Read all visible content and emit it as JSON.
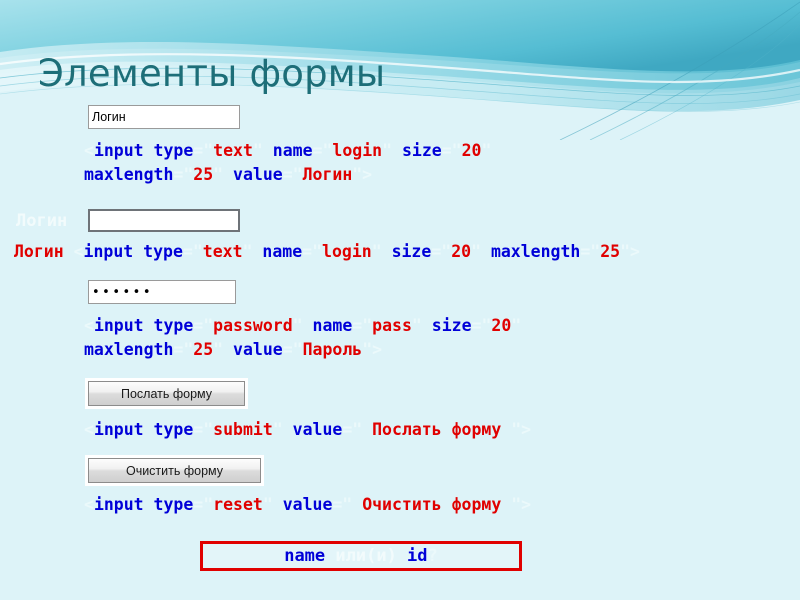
{
  "slide": {
    "title": "Элементы формы",
    "background_color": "#ddf3f8",
    "title_color": "#1d6e78",
    "accent_color": "#5cc3d4"
  },
  "colors": {
    "tag_blue": "#0000d8",
    "value_red": "#e00000",
    "punct_pale": "#ebf9fb",
    "box_border_red": "#e00000"
  },
  "blocks": [
    {
      "id": "text-input-with-value",
      "widget": {
        "type": "text",
        "value": "Логин",
        "placeholder": ""
      },
      "code_lines": [
        [
          {
            "text": "<",
            "cls": "t-pale"
          },
          {
            "text": "input type",
            "cls": "t-blue"
          },
          {
            "text": "=\"",
            "cls": "t-pale"
          },
          {
            "text": "text",
            "cls": "t-red"
          },
          {
            "text": "\" ",
            "cls": "t-pale"
          },
          {
            "text": "name",
            "cls": "t-blue"
          },
          {
            "text": "=\"",
            "cls": "t-pale"
          },
          {
            "text": "login",
            "cls": "t-red"
          },
          {
            "text": "\" ",
            "cls": "t-pale"
          },
          {
            "text": "size",
            "cls": "t-blue"
          },
          {
            "text": "=\"",
            "cls": "t-pale"
          },
          {
            "text": "20",
            "cls": "t-red"
          },
          {
            "text": "\"",
            "cls": "t-pale"
          }
        ],
        [
          {
            "text": "maxlength",
            "cls": "t-blue"
          },
          {
            "text": "=\"",
            "cls": "t-pale"
          },
          {
            "text": "25",
            "cls": "t-red"
          },
          {
            "text": "\" ",
            "cls": "t-pale"
          },
          {
            "text": "value",
            "cls": "t-blue"
          },
          {
            "text": "=\"",
            "cls": "t-pale"
          },
          {
            "text": "Логин",
            "cls": "t-red"
          },
          {
            "text": "\">",
            "cls": "t-pale"
          }
        ]
      ]
    },
    {
      "id": "text-input-empty",
      "label_white": "Логин",
      "widget": {
        "type": "text",
        "value": "",
        "placeholder": ""
      },
      "code_lines": [
        [
          {
            "text": "Логин ",
            "cls": "t-red"
          },
          {
            "text": "<",
            "cls": "t-pale"
          },
          {
            "text": "input type",
            "cls": "t-blue"
          },
          {
            "text": "=\"",
            "cls": "t-pale"
          },
          {
            "text": "text",
            "cls": "t-red"
          },
          {
            "text": "\" ",
            "cls": "t-pale"
          },
          {
            "text": "name",
            "cls": "t-blue"
          },
          {
            "text": "=\"",
            "cls": "t-pale"
          },
          {
            "text": "login",
            "cls": "t-red"
          },
          {
            "text": "\" ",
            "cls": "t-pale"
          },
          {
            "text": "size",
            "cls": "t-blue"
          },
          {
            "text": "=\"",
            "cls": "t-pale"
          },
          {
            "text": "20",
            "cls": "t-red"
          },
          {
            "text": "\" ",
            "cls": "t-pale"
          },
          {
            "text": "maxlength",
            "cls": "t-blue"
          },
          {
            "text": "=\"",
            "cls": "t-pale"
          },
          {
            "text": "25",
            "cls": "t-red"
          },
          {
            "text": "\">",
            "cls": "t-pale"
          }
        ]
      ]
    },
    {
      "id": "password-input",
      "widget": {
        "type": "password",
        "value": "••••••",
        "dot_count": 6
      },
      "code_lines": [
        [
          {
            "text": "<",
            "cls": "t-pale"
          },
          {
            "text": "input type",
            "cls": "t-blue"
          },
          {
            "text": "=\"",
            "cls": "t-pale"
          },
          {
            "text": "password",
            "cls": "t-red"
          },
          {
            "text": "\" ",
            "cls": "t-pale"
          },
          {
            "text": "name",
            "cls": "t-blue"
          },
          {
            "text": "=\"",
            "cls": "t-pale"
          },
          {
            "text": "pass",
            "cls": "t-red"
          },
          {
            "text": "\" ",
            "cls": "t-pale"
          },
          {
            "text": "size",
            "cls": "t-blue"
          },
          {
            "text": "=\"",
            "cls": "t-pale"
          },
          {
            "text": "20",
            "cls": "t-red"
          },
          {
            "text": "\"",
            "cls": "t-pale"
          }
        ],
        [
          {
            "text": "maxlength",
            "cls": "t-blue"
          },
          {
            "text": "=\"",
            "cls": "t-pale"
          },
          {
            "text": "25",
            "cls": "t-red"
          },
          {
            "text": "\" ",
            "cls": "t-pale"
          },
          {
            "text": "value",
            "cls": "t-blue"
          },
          {
            "text": "=\"",
            "cls": "t-pale"
          },
          {
            "text": "Пароль",
            "cls": "t-red"
          },
          {
            "text": "\">",
            "cls": "t-pale"
          }
        ]
      ]
    },
    {
      "id": "submit-button",
      "widget": {
        "type": "submit",
        "label": "Послать форму"
      },
      "code_lines": [
        [
          {
            "text": "<",
            "cls": "t-pale"
          },
          {
            "text": "input type",
            "cls": "t-blue"
          },
          {
            "text": "=\"",
            "cls": "t-pale"
          },
          {
            "text": "submit",
            "cls": "t-red"
          },
          {
            "text": "\" ",
            "cls": "t-pale"
          },
          {
            "text": "value",
            "cls": "t-blue"
          },
          {
            "text": "=\" ",
            "cls": "t-pale"
          },
          {
            "text": "Послать форму",
            "cls": "t-red"
          },
          {
            "text": " \">",
            "cls": "t-pale"
          }
        ]
      ]
    },
    {
      "id": "reset-button",
      "widget": {
        "type": "reset",
        "label": "Очистить форму"
      },
      "code_lines": [
        [
          {
            "text": "<",
            "cls": "t-pale"
          },
          {
            "text": "input type",
            "cls": "t-blue"
          },
          {
            "text": "=\"",
            "cls": "t-pale"
          },
          {
            "text": "reset",
            "cls": "t-red"
          },
          {
            "text": "\" ",
            "cls": "t-pale"
          },
          {
            "text": "value",
            "cls": "t-blue"
          },
          {
            "text": "=\" ",
            "cls": "t-pale"
          },
          {
            "text": "Очистить форму",
            "cls": "t-red"
          },
          {
            "text": " \">",
            "cls": "t-pale"
          }
        ]
      ]
    }
  ],
  "footer_box": {
    "segments": [
      {
        "text": "name",
        "cls": "t-blue"
      },
      {
        "text": " или(и) ",
        "cls": "t-white"
      },
      {
        "text": "id",
        "cls": "t-blue"
      },
      {
        "text": "?",
        "cls": "t-pale"
      }
    ]
  }
}
